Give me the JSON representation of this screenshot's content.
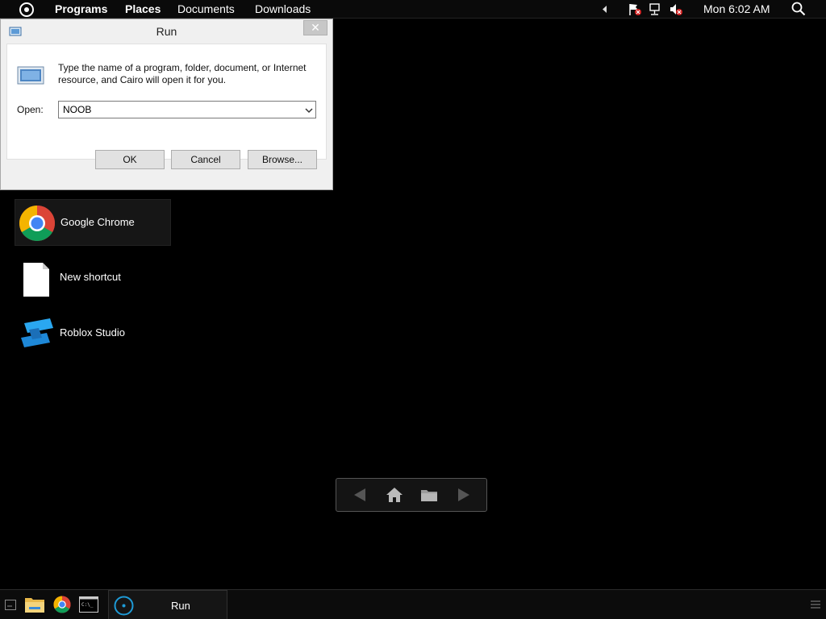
{
  "menubar": {
    "items": [
      "Programs",
      "Places",
      "Documents",
      "Downloads"
    ],
    "clock": "Mon 6:02 AM",
    "icons": [
      "cairo-menu-icon",
      "tray-expand-icon",
      "action-center-flag-icon",
      "network-icon",
      "volume-muted-icon",
      "search-icon"
    ]
  },
  "run_dialog": {
    "title": "Run",
    "description": "Type the name of a program, folder, document, or Internet resource, and Cairo will open it for you.",
    "open_label": "Open:",
    "open_value": "NOOB",
    "buttons": {
      "ok": "OK",
      "cancel": "Cancel",
      "browse": "Browse..."
    },
    "close_symbol": "✕"
  },
  "desktop": {
    "icons": [
      {
        "label": "Google Chrome",
        "icon": "chrome-icon",
        "selected": true
      },
      {
        "label": "New shortcut",
        "icon": "blank-file-icon",
        "selected": false
      },
      {
        "label": "Roblox Studio",
        "icon": "roblox-studio-icon",
        "selected": false
      }
    ]
  },
  "navbar": {
    "icons": [
      "back-arrow-icon",
      "home-icon",
      "folder-icon",
      "forward-arrow-icon"
    ]
  },
  "taskbar": {
    "quick_launch": [
      "desktop-icon",
      "file-explorer-icon",
      "chrome-icon",
      "command-prompt-icon"
    ],
    "active_task": {
      "label": "Run",
      "icon": "cairo-run-icon"
    }
  },
  "colors": {
    "background": "#000000",
    "dialog_bg": "#f0f0f0",
    "accent_blue": "#1e9bd7"
  }
}
